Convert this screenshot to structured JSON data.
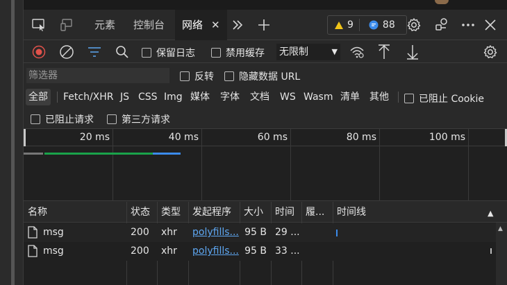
{
  "tabs": {
    "elements": "元素",
    "console": "控制台",
    "network": "网络",
    "more": "»",
    "add": "+"
  },
  "badges": {
    "warnings": "9",
    "messages": "88"
  },
  "toolbar": {
    "preserve_log": "保留日志",
    "disable_cache": "禁用缓存",
    "throttling": "无限制"
  },
  "filter": {
    "placeholder": "筛选器",
    "invert": "反转",
    "hide_data_urls": "隐藏数据 URL"
  },
  "types": [
    "全部",
    "Fetch/XHR",
    "JS",
    "CSS",
    "Img",
    "媒体",
    "字体",
    "文档",
    "WS",
    "Wasm",
    "清单",
    "其他"
  ],
  "blocked_cookies": "已阻止 Cookie",
  "blocked_requests": "已阻止请求",
  "third_party": "第三方请求",
  "overview_ticks": [
    "20 ms",
    "40 ms",
    "60 ms",
    "80 ms",
    "100 ms"
  ],
  "columns": {
    "name": "名称",
    "status": "状态",
    "type": "类型",
    "initiator": "发起程序",
    "size": "大小",
    "time": "时间",
    "fulfilled": "履...",
    "waterfall": "时间线"
  },
  "rows": [
    {
      "name": "msg",
      "status": "200",
      "type": "xhr",
      "initiator": "polyfills...",
      "size": "95 B",
      "time": "29 ..."
    },
    {
      "name": "msg",
      "status": "200",
      "type": "xhr",
      "initiator": "polyfills...",
      "size": "95 B",
      "time": "33 ..."
    }
  ],
  "colors": {
    "accent_blue": "#5ea7f2",
    "record_red": "#e0524b",
    "warning_yellow": "#f0c419",
    "message_blue": "#3b8beb",
    "timeline_green": "#1aa34a"
  }
}
